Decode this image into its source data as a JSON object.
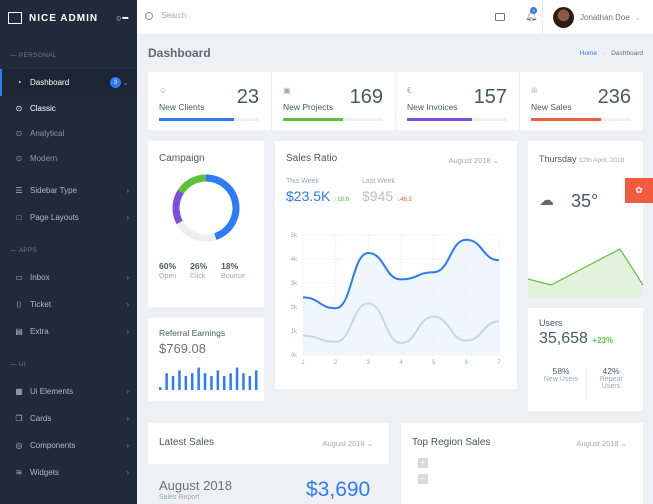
{
  "app": {
    "brand": "NICE ADMIN"
  },
  "sidebar": {
    "sections": [
      "PERSONAL",
      "APPS",
      "UI"
    ],
    "dashboard": {
      "label": "Dashboard",
      "badge": "3"
    },
    "sub": [
      {
        "label": "Classic"
      },
      {
        "label": "Analytical"
      },
      {
        "label": "Modern"
      }
    ],
    "personal": [
      {
        "label": "Sidebar Type",
        "icon": "sliders-icon"
      },
      {
        "label": "Page Layouts",
        "icon": "square-icon"
      }
    ],
    "apps": [
      {
        "label": "Inbox",
        "icon": "inbox-icon"
      },
      {
        "label": "Ticket",
        "icon": "bookmark-icon"
      },
      {
        "label": "Extra",
        "icon": "calculator-icon"
      }
    ],
    "ui": [
      {
        "label": "Ui Elements",
        "icon": "list-icon"
      },
      {
        "label": "Cards",
        "icon": "cards-icon"
      },
      {
        "label": "Components",
        "icon": "target-icon"
      },
      {
        "label": "Widgets",
        "icon": "layers-icon"
      }
    ]
  },
  "topbar": {
    "search_placeholder": "Search",
    "notifications": "3",
    "user": "Jonathan Doe"
  },
  "page": {
    "title": "Dashboard",
    "breadcrumb": [
      "Home",
      "Dashboard"
    ]
  },
  "stats": [
    {
      "label": "New Clients",
      "value": "23",
      "color": "#2d7cf6",
      "progress": 0.75,
      "icon": "smile-icon"
    },
    {
      "label": "New Projects",
      "value": "169",
      "color": "#5ec13a",
      "progress": 0.6,
      "icon": "image-icon"
    },
    {
      "label": "New Invoices",
      "value": "157",
      "color": "#7c4dde",
      "progress": 0.65,
      "icon": "euro-icon"
    },
    {
      "label": "New Sales",
      "value": "236",
      "color": "#f05c3d",
      "progress": 0.7,
      "icon": "bar-chart-icon"
    }
  ],
  "campaign": {
    "title": "Campaign",
    "items": [
      {
        "pct": "60%",
        "label": "Open"
      },
      {
        "pct": "26%",
        "label": "Click"
      },
      {
        "pct": "18%",
        "label": "Bounce"
      }
    ]
  },
  "sales_ratio": {
    "title": "Sales Ratio",
    "month": "August 2018",
    "this_week_label": "This Week",
    "this_week": "$23.5K",
    "this_change": "18.6",
    "last_week_label": "Last Week",
    "last_week": "$945",
    "last_change": "46.3"
  },
  "weather": {
    "day": "Thursday",
    "date": "12th April, 2018",
    "temp": "35°"
  },
  "referral": {
    "title": "Referral Earnings",
    "value": "$769.08"
  },
  "users": {
    "title": "Users",
    "value": "35,658",
    "change": "+23%",
    "new_pct": "58%",
    "new_label": "New Users",
    "repeat_pct": "42%",
    "repeat_label": "Repeat Users"
  },
  "latest_sales": {
    "title": "Latest Sales",
    "month": "August 2018",
    "period": "August 2018",
    "sub": "Sales Report",
    "amount": "$3,690"
  },
  "top_region": {
    "title": "Top Region Sales",
    "month": "August 2018",
    "zoom_in": "+",
    "zoom_out": "−"
  },
  "chart_data": [
    {
      "type": "line",
      "title": "Sales Ratio",
      "x": [
        1,
        2,
        3,
        4,
        5,
        6,
        7
      ],
      "ylim": [
        0,
        5000
      ],
      "yticks": [
        "0k",
        "1k",
        "2k",
        "3k",
        "4k",
        "5k"
      ],
      "series": [
        {
          "name": "This Week",
          "values": [
            2400,
            1950,
            4250,
            3150,
            3450,
            4800,
            3950
          ]
        },
        {
          "name": "Last Week",
          "values": [
            800,
            550,
            2150,
            500,
            1600,
            600,
            1400
          ]
        }
      ]
    },
    {
      "type": "pie",
      "title": "Campaign",
      "labels": [
        "Open",
        "Click",
        "Bounce"
      ],
      "values": [
        60,
        26,
        18
      ]
    },
    {
      "type": "bar",
      "title": "Referral Earnings",
      "values": [
        1,
        6,
        5,
        7,
        5,
        6,
        8,
        6,
        5,
        7,
        5,
        6,
        8,
        6,
        5,
        7
      ]
    },
    {
      "type": "area",
      "title": "Weather",
      "values": [
        3,
        2,
        4,
        6,
        8,
        2
      ]
    }
  ]
}
